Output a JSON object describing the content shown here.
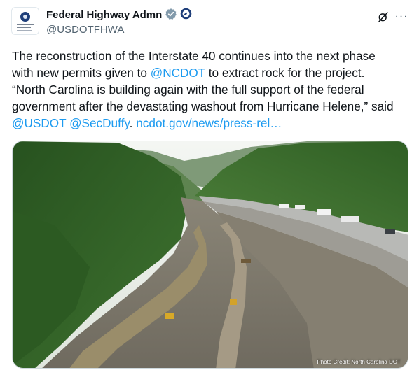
{
  "account": {
    "display_name": "Federal Highway Admn",
    "handle": "@USDOTFHWA",
    "avatar_icon": "dot-seal-logo",
    "verified_icon": "verified-badge-icon",
    "affiliate_icon": "dot-affiliate-badge-icon"
  },
  "actions": {
    "grok_icon": "grok-icon",
    "more_label": "···"
  },
  "tweet": {
    "line1": "The reconstruction of the Interstate 40 continues into the next phase",
    "line2_pre": "with new permits given to ",
    "line2_mention": "@NCDOT",
    "line2_post": " to extract rock for the project.",
    "line3": "“North Carolina is building again with the full support of the federal",
    "line4": "government after the devastating washout from Hurricane Helene,” said",
    "mention1": "@USDOT",
    "mention2": "@SecDuffy",
    "link": "ncdot.gov/news/press-rel…"
  },
  "media": {
    "alt": "Aerial view of washed-out Interstate 40 gorge",
    "credit": "Photo Credit: North Carolina DOT"
  },
  "colors": {
    "link": "#1d9bf0",
    "text": "#0f1419",
    "secondary": "#536471"
  }
}
